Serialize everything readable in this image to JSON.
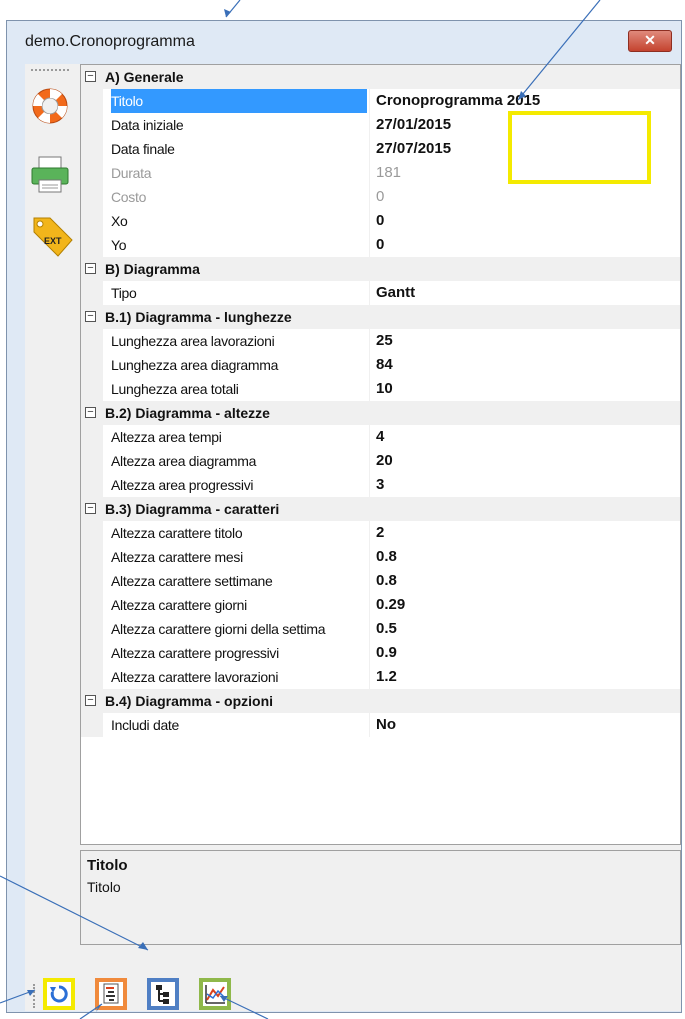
{
  "window": {
    "title": "demo.Cronoprogramma",
    "close_symbol": "✕"
  },
  "toolbar_left": [
    {
      "icon": "lifebuoy-icon"
    },
    {
      "icon": "printer-icon"
    },
    {
      "icon": "ext-tag-icon",
      "label": "EXT"
    }
  ],
  "grid": {
    "categories": [
      {
        "label": "A) Generale",
        "toggle": "−",
        "props": [
          {
            "name": "Titolo",
            "value": "Cronoprogramma 2015",
            "selected": true
          },
          {
            "name": "Data iniziale",
            "value": "27/01/2015"
          },
          {
            "name": "Data finale",
            "value": "27/07/2015"
          },
          {
            "name": "Durata",
            "value": "181",
            "disabled": true
          },
          {
            "name": "Costo",
            "value": "0",
            "disabled": true
          },
          {
            "name": "Xo",
            "value": "0"
          },
          {
            "name": "Yo",
            "value": "0"
          }
        ]
      },
      {
        "label": "B) Diagramma",
        "toggle": "−",
        "props": [
          {
            "name": "Tipo",
            "value": "Gantt"
          }
        ]
      },
      {
        "label": "B.1) Diagramma - lunghezze",
        "toggle": "−",
        "props": [
          {
            "name": "Lunghezza area lavorazioni",
            "value": "25"
          },
          {
            "name": "Lunghezza area diagramma",
            "value": "84"
          },
          {
            "name": "Lunghezza area totali",
            "value": "10"
          }
        ]
      },
      {
        "label": "B.2) Diagramma - altezze",
        "toggle": "−",
        "props": [
          {
            "name": "Altezza area tempi",
            "value": "4"
          },
          {
            "name": "Altezza area diagramma",
            "value": "20"
          },
          {
            "name": "Altezza area progressivi",
            "value": "3"
          }
        ]
      },
      {
        "label": "B.3) Diagramma - caratteri",
        "toggle": "−",
        "props": [
          {
            "name": "Altezza carattere titolo",
            "value": "2"
          },
          {
            "name": "Altezza carattere mesi",
            "value": "0.8"
          },
          {
            "name": "Altezza carattere settimane",
            "value": "0.8"
          },
          {
            "name": "Altezza carattere giorni",
            "value": "0.29"
          },
          {
            "name": "Altezza carattere giorni della settima",
            "value": "0.5"
          },
          {
            "name": "Altezza carattere progressivi",
            "value": "0.9"
          },
          {
            "name": "Altezza carattere lavorazioni",
            "value": "1.2"
          }
        ]
      },
      {
        "label": "B.4) Diagramma - opzioni",
        "toggle": "−",
        "props": [
          {
            "name": "Includi date",
            "value": "No"
          }
        ]
      }
    ]
  },
  "help": {
    "title": "Titolo",
    "description": "Titolo"
  },
  "bottom_toolbar": [
    {
      "icon": "refresh-icon",
      "highlight": "#f4ea00"
    },
    {
      "icon": "gantt-report-icon",
      "highlight": "#f08a3c"
    },
    {
      "icon": "tree-structure-icon",
      "highlight": "#4f7fc4"
    },
    {
      "icon": "chart-graph-icon",
      "highlight": "#8fb84a"
    }
  ],
  "colors": {
    "selection": "#3399ff",
    "annotation_yellow": "#f4ea00",
    "annotation_arrow": "#3a6fb8"
  }
}
